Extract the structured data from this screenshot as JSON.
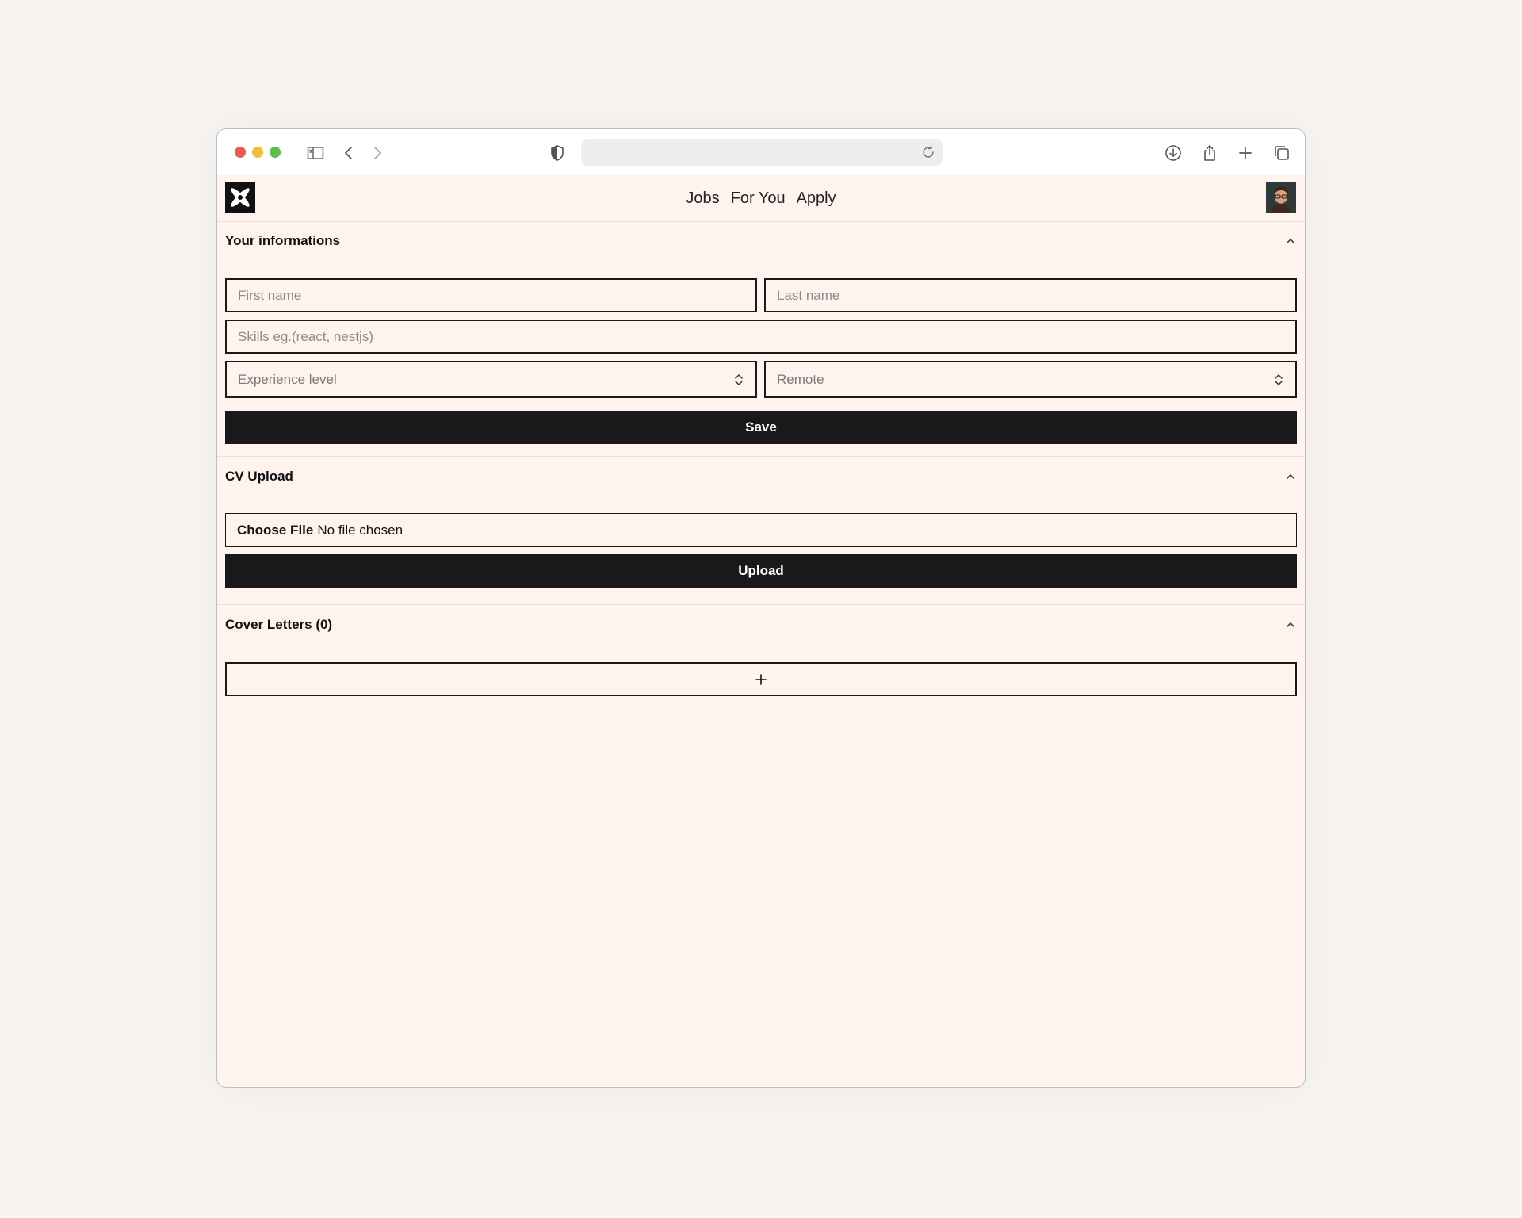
{
  "browser": {
    "url": "",
    "icons": [
      "sidebar-icon",
      "back-icon",
      "forward-icon",
      "shield-icon",
      "reload-icon",
      "download-icon",
      "share-icon",
      "new-tab-icon",
      "tabs-overview-icon"
    ]
  },
  "nav": {
    "links": [
      {
        "label": "Jobs"
      },
      {
        "label": "For You"
      },
      {
        "label": "Apply"
      }
    ]
  },
  "sections": {
    "info": {
      "title": "Your informations",
      "first_name_placeholder": "First name",
      "last_name_placeholder": "Last name",
      "skills_placeholder": "Skills eg.(react, nestjs)",
      "experience_placeholder": "Experience level",
      "remote_placeholder": "Remote",
      "save_label": "Save"
    },
    "cv": {
      "title": "CV Upload",
      "choose_file_label": "Choose File",
      "file_status": "No file chosen",
      "upload_label": "Upload"
    },
    "cover_letters": {
      "title": "Cover Letters (0)",
      "add_icon": "plus-icon"
    }
  },
  "colors": {
    "page_bg": "#fff3ee",
    "button_dark": "#19191b",
    "border": "#1a1a1a"
  }
}
